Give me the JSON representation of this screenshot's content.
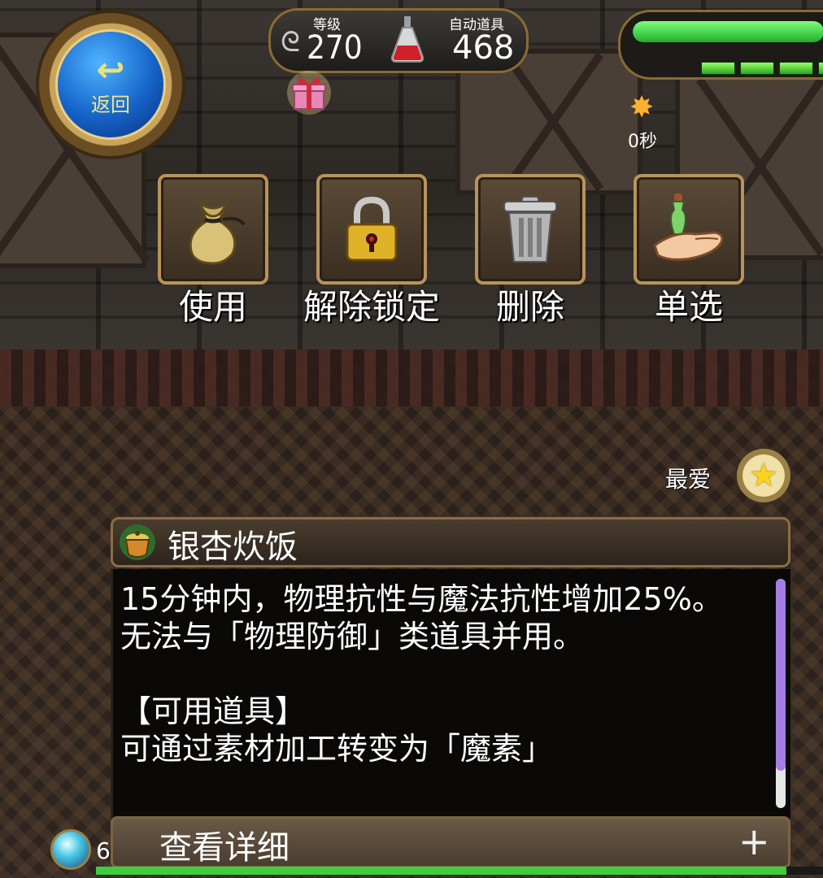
{
  "return_button": {
    "label": "返回",
    "icon": "return-arrow-icon"
  },
  "stats": {
    "level_label": "等级",
    "level_value": "270",
    "auto_item_label": "自动道具",
    "auto_item_value": "468"
  },
  "hud": {
    "hp_fraction": 0.98,
    "mp_segments": 4,
    "buff_timer": "0秒",
    "exp_fraction": 0.95,
    "orb_count": "6"
  },
  "actions": [
    {
      "label": "使用",
      "icon": "sack-icon"
    },
    {
      "label": "解除锁定",
      "icon": "padlock-icon"
    },
    {
      "label": "删除",
      "icon": "trash-can-icon"
    },
    {
      "label": "单选",
      "icon": "hand-potion-icon"
    }
  ],
  "favorite": {
    "label": "最爱",
    "icon": "star-icon"
  },
  "item": {
    "name": "银杏炊饭",
    "description": "15分钟内，物理抗性与魔法抗性增加25%。\n无法与「物理防御」类道具并用。\n\n【可用道具】\n可通过素材加工转变为「魔素」"
  },
  "detail_button": {
    "label": "查看详细",
    "expand_symbol": "+"
  },
  "colors": {
    "hp_green": "#1fae2a",
    "scroll_thumb": "#a67de6",
    "frame_gold": "#b8935a"
  }
}
